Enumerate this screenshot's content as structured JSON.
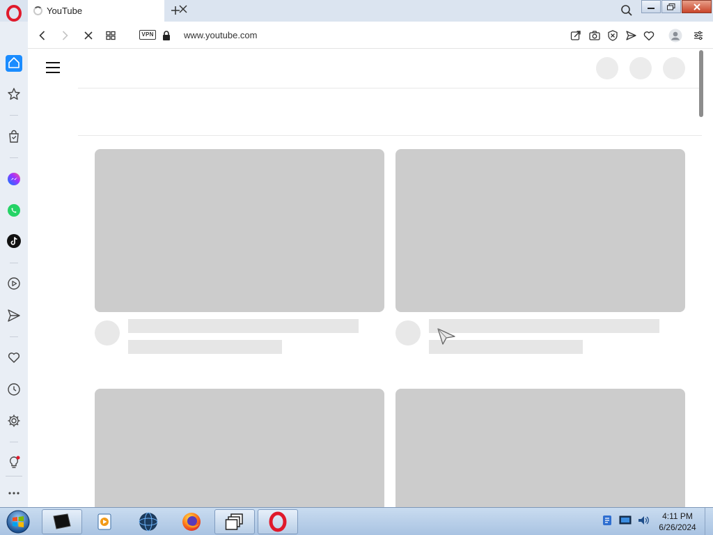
{
  "browser": {
    "tab": {
      "title": "YouTube",
      "close_icon": "close-icon",
      "status": "loading"
    },
    "address_bar": {
      "url": "www.youtube.com",
      "vpn_label": "VPN"
    },
    "toolbar_icons": [
      "back-icon",
      "forward-icon",
      "stop-icon",
      "tab-grid-icon",
      "lock-icon",
      "share-icon",
      "camera-icon",
      "adblock-icon",
      "send-icon",
      "heart-icon",
      "account-icon",
      "easy-setup-icon"
    ],
    "sidebar_items": [
      "home-icon",
      "star-icon",
      "shopping-icon",
      "messenger-icon",
      "whatsapp-icon",
      "tiktok-icon",
      "player-icon",
      "flow-icon",
      "heart-icon",
      "history-icon",
      "settings-icon",
      "tips-icon",
      "more-icon"
    ]
  },
  "taskbar": {
    "clock_time": "4:11 PM",
    "clock_date": "6/26/2024",
    "apps": [
      "terminal-app-icon",
      "media-player-app-icon",
      "globe-app-icon",
      "firefox-app-icon",
      "window-switcher-app-icon",
      "opera-app-icon"
    ]
  },
  "colors": {
    "accent": "#1a8cff",
    "opera_red": "#ff1b2d",
    "placeholder_thumb": "#cccccc",
    "placeholder_line": "#e6e6e6"
  }
}
